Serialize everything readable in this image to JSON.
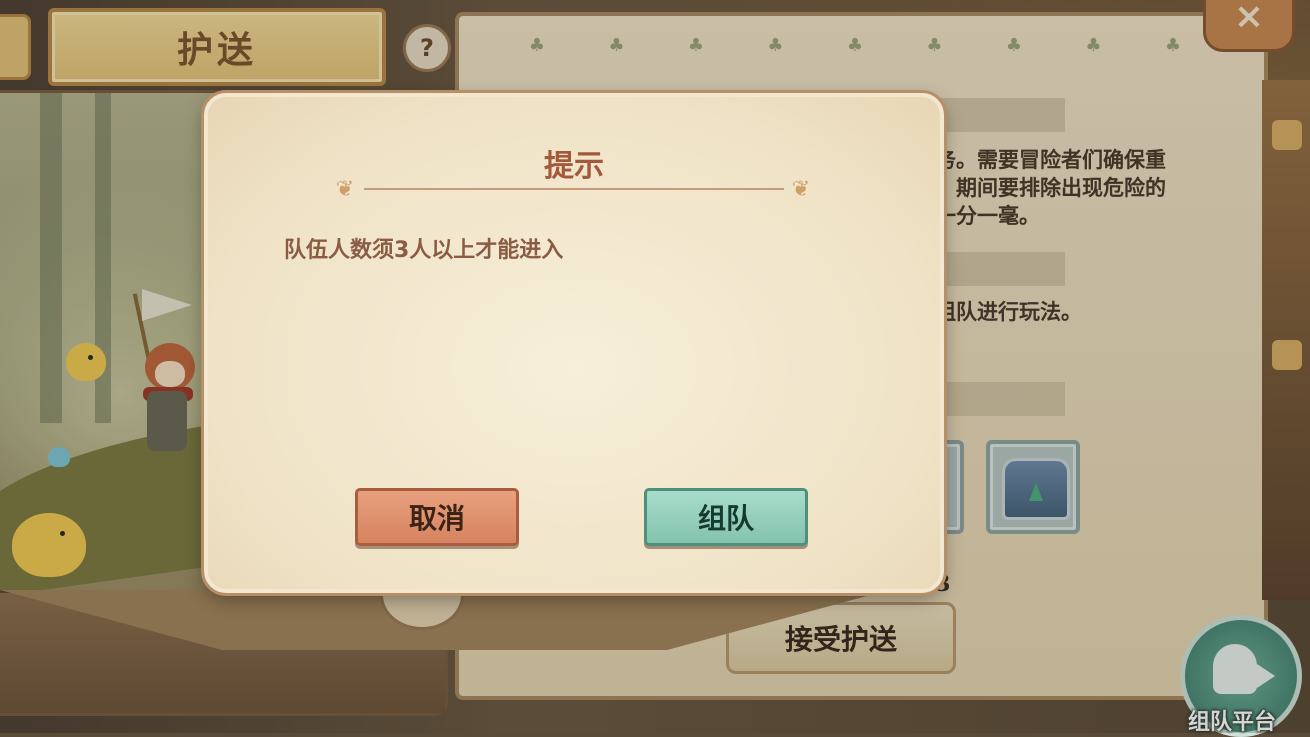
{
  "header": {
    "title": "护送",
    "help_label": "?"
  },
  "close_label": "×",
  "description": {
    "line1": "务。需要冒险者们确保重",
    "line2": "。期间要排除出现危险的",
    "line3": "一分一毫。",
    "line4": "组队进行玩法。"
  },
  "reward": {
    "count_label": "今日奖励剩余次数: 3/3"
  },
  "accept_button": "接受护送",
  "team_platform_label": "组队平台",
  "dialog": {
    "title": "提示",
    "message": "队伍人数须3人以上才能进入",
    "cancel_label": "取消",
    "team_label": "组队"
  },
  "colors": {
    "cancel_button": "#d98a66",
    "team_button": "#92cdb9",
    "dialog_title": "#a35a3c",
    "message_text": "#8a5c44"
  },
  "icons": [
    "help-icon",
    "close-icon",
    "leaf-icon",
    "treasure-chest-icon",
    "team-platform-icon"
  ]
}
